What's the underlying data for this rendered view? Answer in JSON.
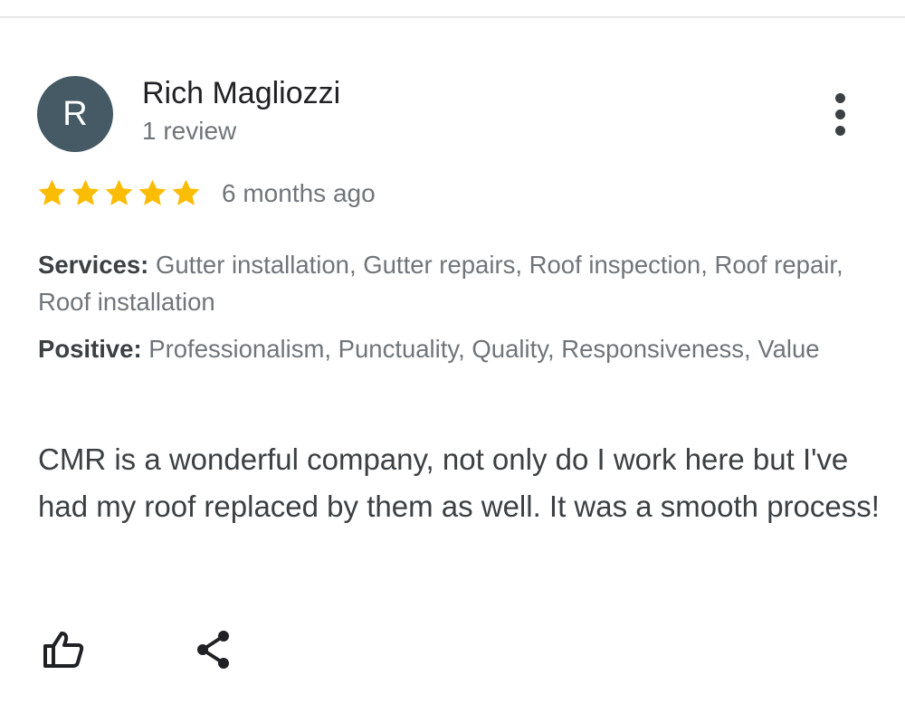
{
  "review": {
    "avatar_letter": "R",
    "reviewer_name": "Rich Magliozzi",
    "review_count": "1 review",
    "rating": 5,
    "max_rating": 5,
    "star_color": "#fbbc04",
    "date": "6 months ago",
    "services_label": "Services:",
    "services_value": "Gutter installation, Gutter repairs, Roof inspection, Roof repair, Roof installation",
    "positive_label": "Positive:",
    "positive_value": "Professionalism, Punctuality, Quality, Responsiveness, Value",
    "text": "CMR is a wonderful company, not only do I work here but I've had my roof replaced by them as well. It was a smooth process!"
  },
  "icons": {
    "more": "more-vert-icon",
    "like": "thumbs-up-icon",
    "share": "share-icon"
  }
}
